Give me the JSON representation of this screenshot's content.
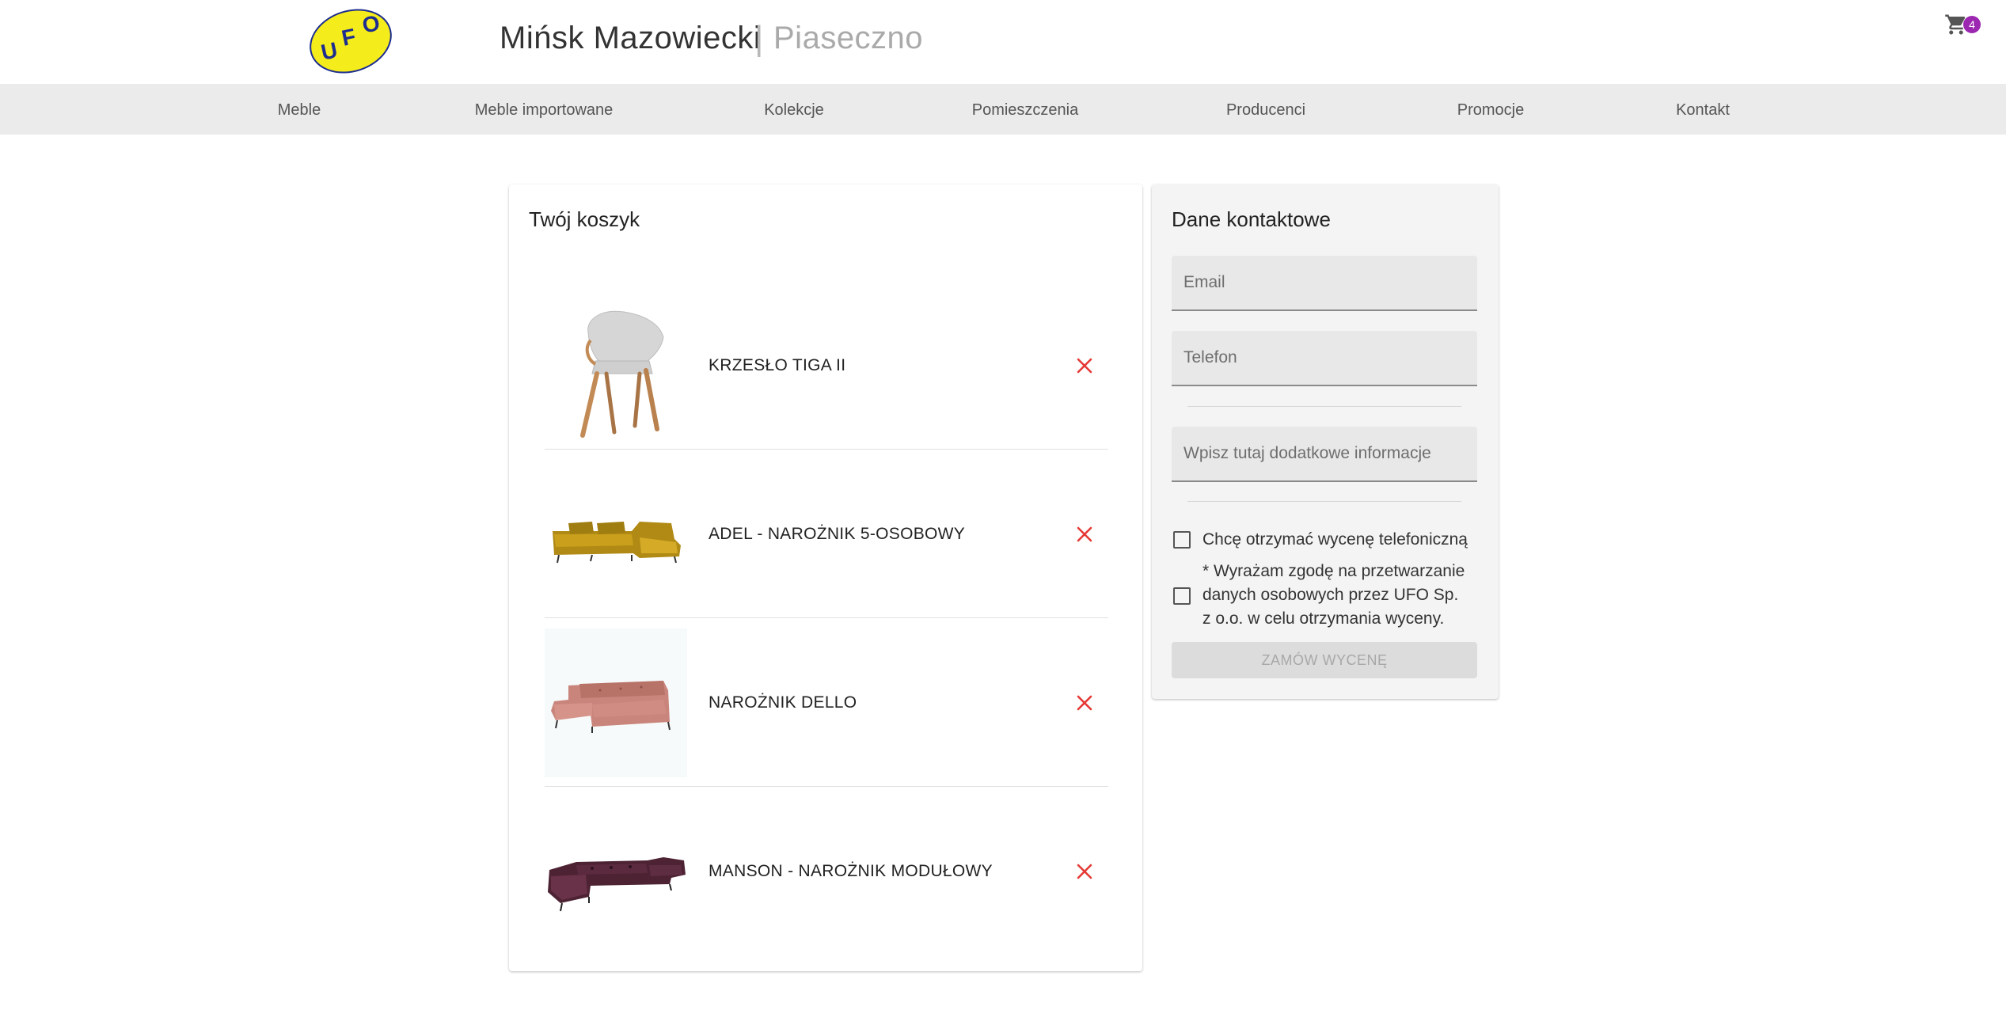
{
  "header": {
    "logo_text": "UFO",
    "city_primary": "Mińsk Mazowiecki",
    "separator": "|",
    "city_secondary": "Piaseczno",
    "cart_count": "4",
    "cart_icon": "shopping-cart-icon"
  },
  "nav": {
    "items": [
      {
        "label": "Meble"
      },
      {
        "label": "Meble importowane"
      },
      {
        "label": "Kolekcje"
      },
      {
        "label": "Pomieszczenia"
      },
      {
        "label": "Producenci"
      },
      {
        "label": "Promocje"
      },
      {
        "label": "Kontakt"
      }
    ]
  },
  "cart": {
    "title": "Twój koszyk",
    "items": [
      {
        "name": "KRZESŁO TIGA II",
        "image": "chair-image"
      },
      {
        "name": "ADEL - NAROŻNIK 5-OSOBOWY",
        "image": "corner-sofa-mustard-image"
      },
      {
        "name": "NAROŻNIK DELLO",
        "image": "corner-sofa-pink-image"
      },
      {
        "name": "MANSON - NAROŻNIK MODUŁOWY",
        "image": "modular-sofa-burgundy-image"
      }
    ],
    "remove_icon": "close-icon",
    "colors": {
      "remove": "#e53935"
    }
  },
  "contact": {
    "title": "Dane kontaktowe",
    "email_placeholder": "Email",
    "phone_placeholder": "Telefon",
    "info_placeholder": "Wpisz tutaj dodatkowe informacje",
    "checkbox_phone_label": "Chcę otrzymać wycenę telefoniczną",
    "consent_line1": "* Wyrażam zgodę na przetwarzanie",
    "consent_line2": "danych osobowych przez UFO Sp.",
    "consent_line3": "z o.o. w celu otrzymania wyceny.",
    "submit_label": "ZAMÓW WYCENĘ"
  },
  "colors": {
    "nav_bg": "#ebebeb",
    "badge": "#9c27b0",
    "logo_yellow": "#f5ec1c",
    "logo_blue": "#1c2d8f"
  }
}
